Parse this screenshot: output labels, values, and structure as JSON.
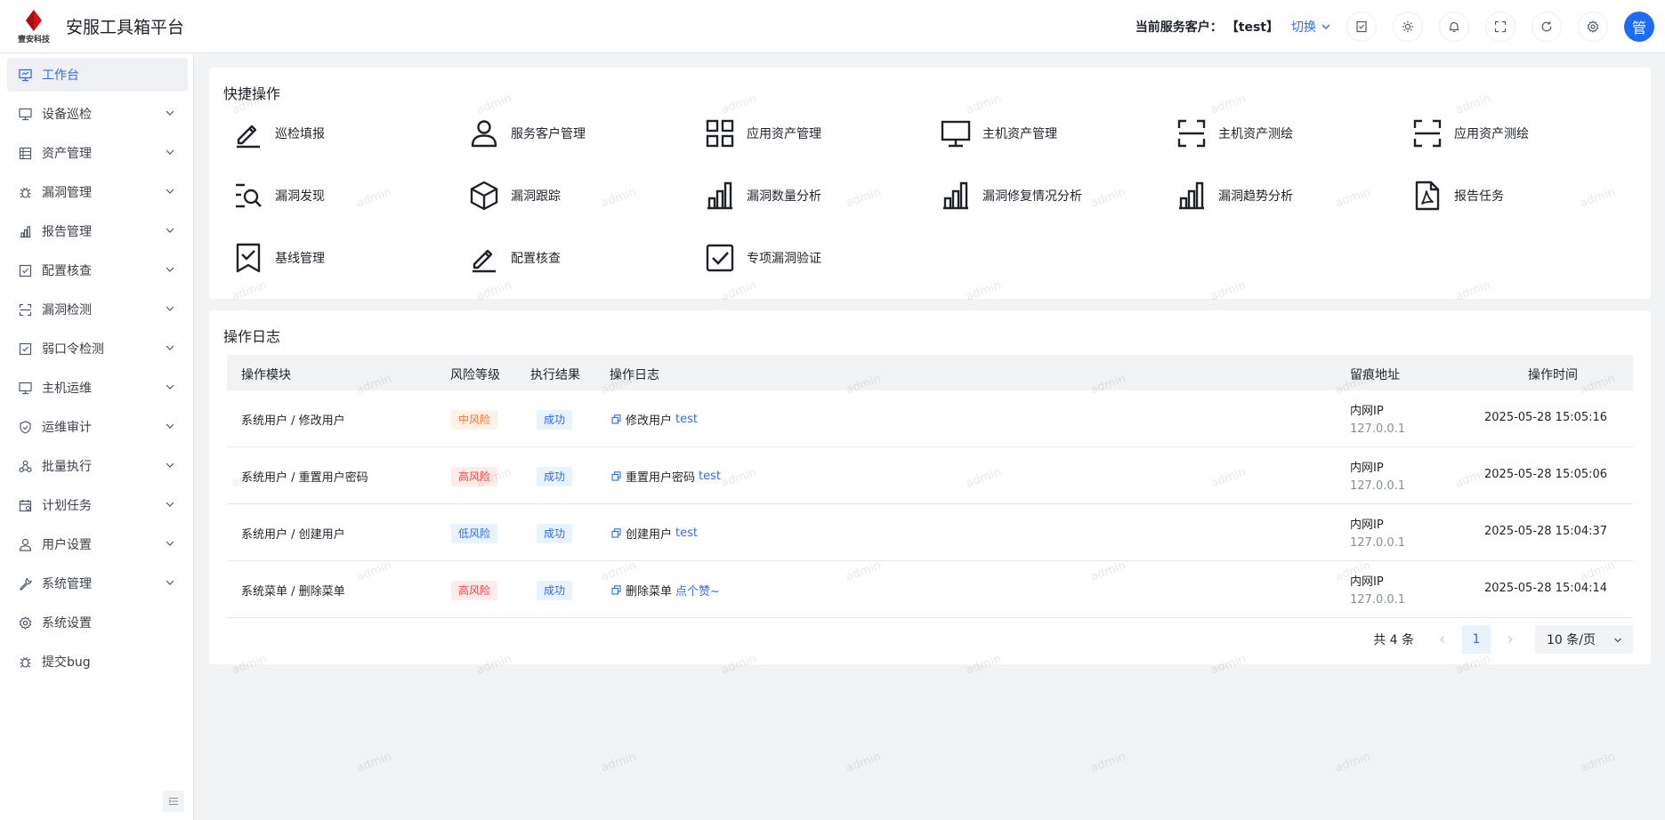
{
  "header": {
    "logo_text": "壹安科技",
    "app_title": "安服工具箱平台",
    "customer_label": "当前服务客户：",
    "customer_value": "【test】",
    "switch_label": "切换",
    "avatar_text": "管",
    "icons": [
      "checklist-icon",
      "theme-icon",
      "bell-icon",
      "fullscreen-icon",
      "refresh-icon",
      "settings-icon"
    ]
  },
  "sidebar": {
    "items": [
      {
        "label": "工作台",
        "icon": "monitor-icon",
        "active": true
      },
      {
        "label": "设备巡检",
        "icon": "monitor-icon"
      },
      {
        "label": "资产管理",
        "icon": "list-icon"
      },
      {
        "label": "漏洞管理",
        "icon": "bug-icon"
      },
      {
        "label": "报告管理",
        "icon": "chart-icon"
      },
      {
        "label": "配置核查",
        "icon": "check-square-icon"
      },
      {
        "label": "漏洞检测",
        "icon": "scan-icon"
      },
      {
        "label": "弱口令检测",
        "icon": "check-square-icon"
      },
      {
        "label": "主机运维",
        "icon": "monitor-icon"
      },
      {
        "label": "运维审计",
        "icon": "shield-icon"
      },
      {
        "label": "批量执行",
        "icon": "nodes-icon"
      },
      {
        "label": "计划任务",
        "icon": "calendar-icon"
      },
      {
        "label": "用户设置",
        "icon": "user-icon"
      },
      {
        "label": "系统管理",
        "icon": "wrench-icon"
      },
      {
        "label": "系统设置",
        "icon": "gear-icon"
      },
      {
        "label": "提交bug",
        "icon": "bug-icon"
      }
    ]
  },
  "quick": {
    "title": "快捷操作",
    "items": [
      {
        "label": "巡检填报",
        "icon": "edit-icon"
      },
      {
        "label": "服务客户管理",
        "icon": "user-icon"
      },
      {
        "label": "应用资产管理",
        "icon": "grid-icon"
      },
      {
        "label": "主机资产管理",
        "icon": "monitor-icon"
      },
      {
        "label": "主机资产测绘",
        "icon": "scan-icon"
      },
      {
        "label": "应用资产测绘",
        "icon": "scan-icon"
      },
      {
        "label": "漏洞发现",
        "icon": "search-list-icon"
      },
      {
        "label": "漏洞跟踪",
        "icon": "cube-icon"
      },
      {
        "label": "漏洞数量分析",
        "icon": "bar-chart-icon"
      },
      {
        "label": "漏洞修复情况分析",
        "icon": "bar-chart-icon"
      },
      {
        "label": "漏洞趋势分析",
        "icon": "bar-chart-icon"
      },
      {
        "label": "报告任务",
        "icon": "pdf-file-icon"
      },
      {
        "label": "基线管理",
        "icon": "bookmark-check-icon"
      },
      {
        "label": "配置核查",
        "icon": "edit-icon"
      },
      {
        "label": "专项漏洞验证",
        "icon": "check-square-icon"
      }
    ]
  },
  "log": {
    "title": "操作日志",
    "columns": [
      "操作模块",
      "风险等级",
      "执行结果",
      "操作日志",
      "留痕地址",
      "操作时间"
    ],
    "rows": [
      {
        "module": "系统用户 / 修改用户",
        "risk": "中风险",
        "risk_level": "mid",
        "result": "成功",
        "action": "修改用户",
        "target": "test",
        "ip_label": "内网IP",
        "ip": "127.0.0.1",
        "time": "2025-05-28 15:05:16"
      },
      {
        "module": "系统用户 / 重置用户密码",
        "risk": "高风险",
        "risk_level": "high",
        "result": "成功",
        "action": "重置用户密码",
        "target": "test",
        "ip_label": "内网IP",
        "ip": "127.0.0.1",
        "time": "2025-05-28 15:05:06"
      },
      {
        "module": "系统用户 / 创建用户",
        "risk": "低风险",
        "risk_level": "low",
        "result": "成功",
        "action": "创建用户",
        "target": "test",
        "ip_label": "内网IP",
        "ip": "127.0.0.1",
        "time": "2025-05-28 15:04:37"
      },
      {
        "module": "系统菜单 / 删除菜单",
        "risk": "高风险",
        "risk_level": "high",
        "result": "成功",
        "action": "删除菜单",
        "target": "点个赞~",
        "ip_label": "内网IP",
        "ip": "127.0.0.1",
        "time": "2025-05-28 15:04:14"
      }
    ],
    "pagination": {
      "total": "共 4 条",
      "page": "1",
      "page_size": "10 条/页"
    }
  },
  "watermark": "admin",
  "colors": {
    "accent": "#2f6bf0",
    "brand_red": "#d7141a",
    "high_risk": "#f53f3f",
    "mid_risk": "#f77234"
  }
}
